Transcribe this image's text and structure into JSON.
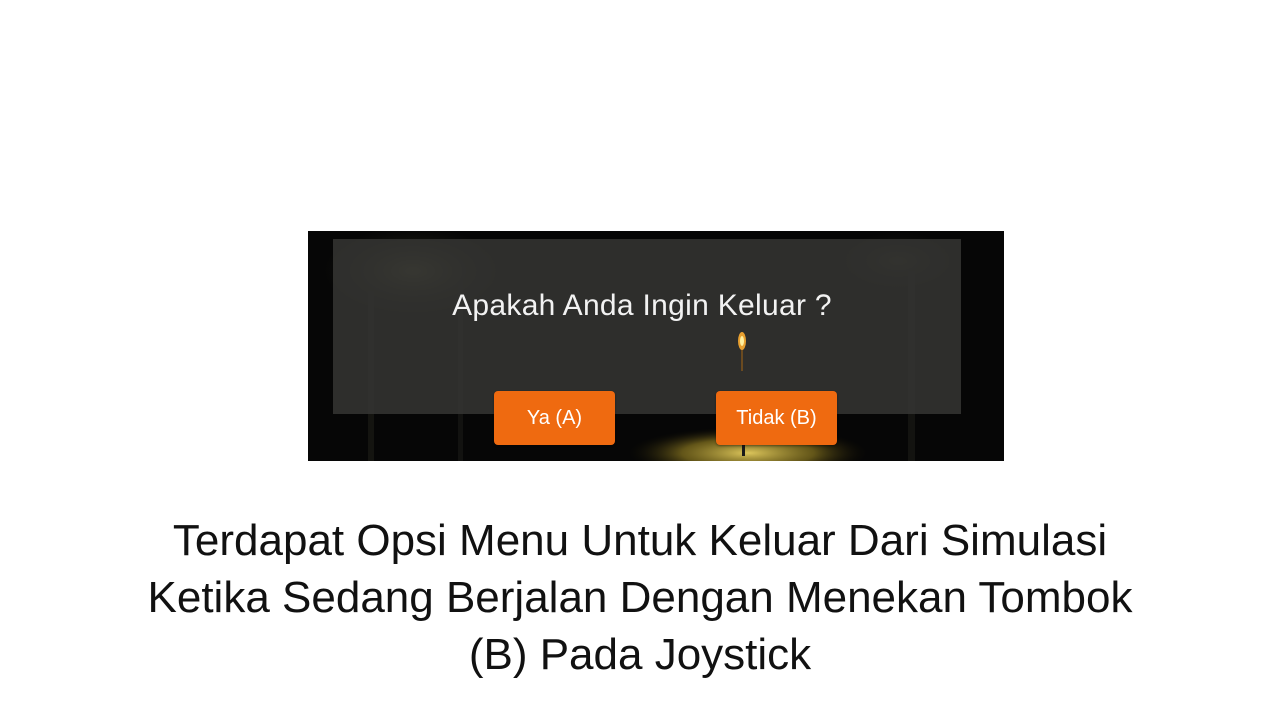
{
  "dialog": {
    "question": "Apakah Anda Ingin Keluar ?",
    "yes_label": "Ya (A)",
    "no_label": "Tidak (B)"
  },
  "caption": {
    "lines": [
      "Terdapat Opsi Menu Untuk Keluar Dari Simulasi",
      "Ketika Sedang Berjalan Dengan Menekan Tombok",
      "(B) Pada Joystick"
    ]
  },
  "colors": {
    "button": "#ef6a10",
    "panel": "#343432",
    "background": "#050505"
  }
}
